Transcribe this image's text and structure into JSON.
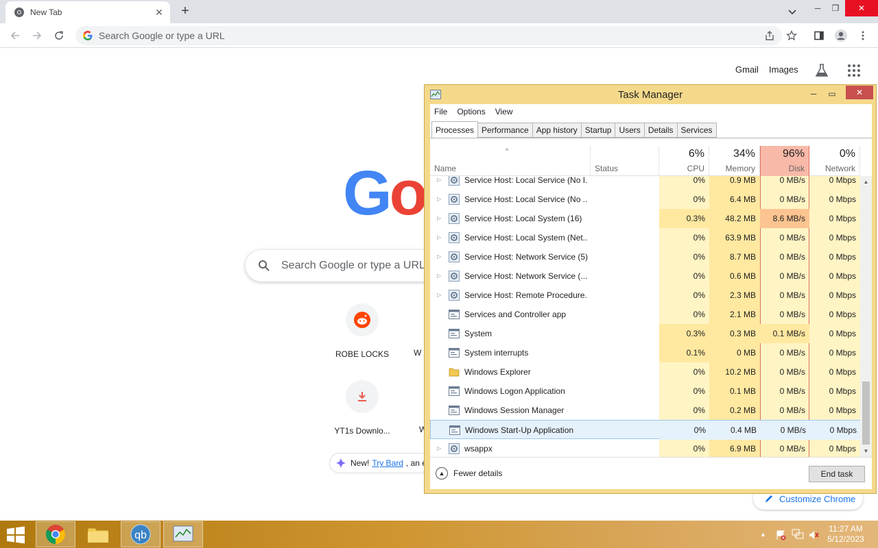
{
  "browser": {
    "tab_title": "New Tab",
    "omnibox_placeholder": "Search Google or type a URL"
  },
  "ntp": {
    "gmail": "Gmail",
    "images": "Images",
    "search_placeholder": "Search Google or type a URL",
    "logo_visible": "Go",
    "shortcuts": [
      {
        "label": "ROBE LOCKS"
      },
      {
        "label": "YT1s Downlo..."
      },
      {
        "label": "W"
      },
      {
        "label": "W"
      }
    ],
    "bard": {
      "new": "New!",
      "link": "Try Bard",
      "rest": ", an ea"
    },
    "customize": "Customize Chrome"
  },
  "taskmanager": {
    "title": "Task Manager",
    "menu": [
      "File",
      "Options",
      "View"
    ],
    "tabs": [
      "Processes",
      "Performance",
      "App history",
      "Startup",
      "Users",
      "Details",
      "Services"
    ],
    "columns": {
      "name": "Name",
      "status": "Status",
      "cpu": {
        "pct": "6%",
        "label": "CPU"
      },
      "memory": {
        "pct": "34%",
        "label": "Memory"
      },
      "disk": {
        "pct": "96%",
        "label": "Disk"
      },
      "network": {
        "pct": "0%",
        "label": "Network"
      }
    },
    "rows": [
      {
        "name": "Service Host: Local Service (No I...",
        "cpu": "0%",
        "mem": "0.9 MB",
        "disk": "0 MB/s",
        "net": "0 Mbps",
        "icon": "gear-icon",
        "expand": true
      },
      {
        "name": "Service Host: Local Service (No ...",
        "cpu": "0%",
        "mem": "6.4 MB",
        "disk": "0 MB/s",
        "net": "0 Mbps",
        "icon": "gear-icon",
        "expand": true
      },
      {
        "name": "Service Host: Local System (16)",
        "cpu": "0.3%",
        "mem": "48.2 MB",
        "disk": "8.6 MB/s",
        "net": "0 Mbps",
        "icon": "gear-icon",
        "expand": true
      },
      {
        "name": "Service Host: Local System (Net...",
        "cpu": "0%",
        "mem": "63.9 MB",
        "disk": "0 MB/s",
        "net": "0 Mbps",
        "icon": "gear-icon",
        "expand": true
      },
      {
        "name": "Service Host: Network Service (5)",
        "cpu": "0%",
        "mem": "8.7 MB",
        "disk": "0 MB/s",
        "net": "0 Mbps",
        "icon": "gear-icon",
        "expand": true
      },
      {
        "name": "Service Host: Network Service (...",
        "cpu": "0%",
        "mem": "0.6 MB",
        "disk": "0 MB/s",
        "net": "0 Mbps",
        "icon": "gear-icon",
        "expand": true
      },
      {
        "name": "Service Host: Remote Procedure...",
        "cpu": "0%",
        "mem": "2.3 MB",
        "disk": "0 MB/s",
        "net": "0 Mbps",
        "icon": "gear-icon",
        "expand": true
      },
      {
        "name": "Services and Controller app",
        "cpu": "0%",
        "mem": "2.1 MB",
        "disk": "0 MB/s",
        "net": "0 Mbps",
        "icon": "window-icon",
        "expand": false
      },
      {
        "name": "System",
        "cpu": "0.3%",
        "mem": "0.3 MB",
        "disk": "0.1 MB/s",
        "net": "0 Mbps",
        "icon": "window-icon",
        "expand": false
      },
      {
        "name": "System interrupts",
        "cpu": "0.1%",
        "mem": "0 MB",
        "disk": "0 MB/s",
        "net": "0 Mbps",
        "icon": "window-icon",
        "expand": false
      },
      {
        "name": "Windows Explorer",
        "cpu": "0%",
        "mem": "10.2 MB",
        "disk": "0 MB/s",
        "net": "0 Mbps",
        "icon": "folder-icon",
        "expand": false
      },
      {
        "name": "Windows Logon Application",
        "cpu": "0%",
        "mem": "0.1 MB",
        "disk": "0 MB/s",
        "net": "0 Mbps",
        "icon": "window-icon",
        "expand": false
      },
      {
        "name": "Windows Session Manager",
        "cpu": "0%",
        "mem": "0.2 MB",
        "disk": "0 MB/s",
        "net": "0 Mbps",
        "icon": "window-icon",
        "expand": false
      },
      {
        "name": "Windows Start-Up Application",
        "cpu": "0%",
        "mem": "0.4 MB",
        "disk": "0 MB/s",
        "net": "0 Mbps",
        "icon": "window-icon",
        "expand": false,
        "selected": true
      },
      {
        "name": "wsappx",
        "cpu": "0%",
        "mem": "6.9 MB",
        "disk": "0 MB/s",
        "net": "0 Mbps",
        "icon": "gear-icon",
        "expand": true
      }
    ],
    "fewer_details": "Fewer details",
    "end_task": "End task"
  },
  "taskbar": {
    "time": "11:27 AM",
    "date": "5/12/2023"
  },
  "colors": {
    "disk_header": "#f9b9a8",
    "disk_border": "#e07060",
    "heat_light": "#fff4c4",
    "heat_medium": "#ffe8a0",
    "heat_high": "#fbc490",
    "tm_frame": "#f5d98b"
  }
}
